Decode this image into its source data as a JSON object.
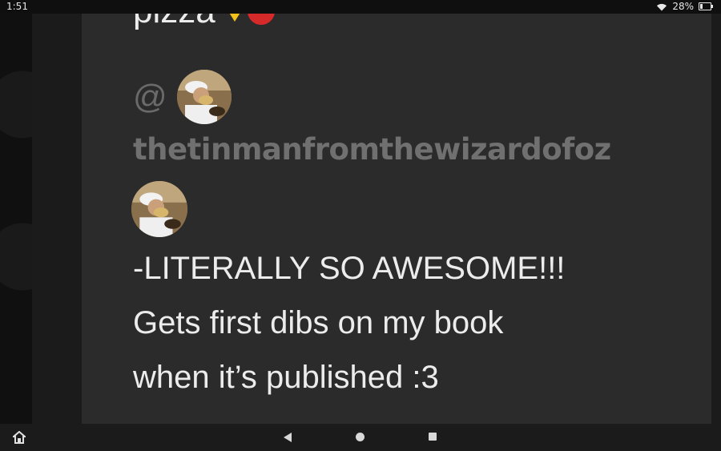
{
  "status_bar": {
    "time": "1:51",
    "battery_percent": "28%",
    "battery_level": 0.28,
    "icons": [
      "wifi-icon",
      "battery-icon"
    ]
  },
  "post": {
    "top_text": "pizza",
    "top_icons": [
      "pizza-icon",
      "heart-icon"
    ],
    "mention_symbol": "@",
    "username": "thetinmanfromthewizardofoz",
    "message_lines": [
      "-LITERALLY SO AWESOME!!!",
      "Gets first dibs on my book",
      "when it’s published :3"
    ]
  },
  "nav_bar": {
    "icons": [
      "home-icon",
      "back-icon",
      "home-circle-icon",
      "recents-icon"
    ]
  },
  "colors": {
    "card_background": "#2b2b2b",
    "page_background": "#1b1b1b",
    "text_primary": "#ececec",
    "text_muted": "#707070"
  }
}
